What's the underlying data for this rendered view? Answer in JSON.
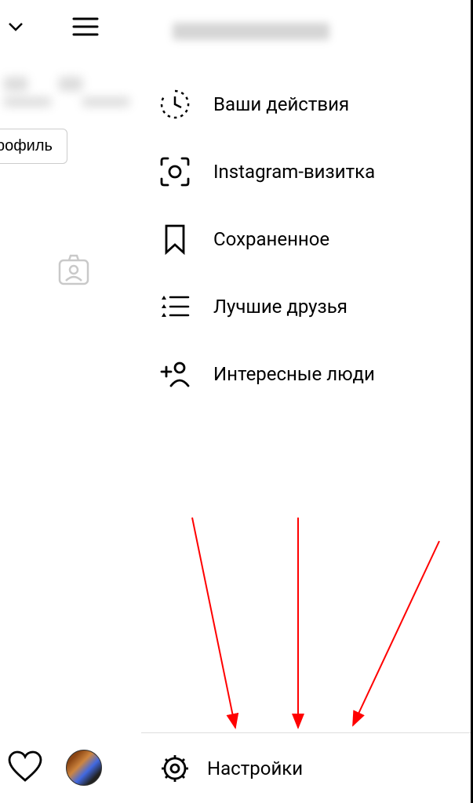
{
  "header": {
    "username_blurred": true
  },
  "profile": {
    "edit_profile_label": "ть профиль"
  },
  "menu": {
    "items": [
      {
        "icon": "activity-icon",
        "label": "Ваши действия"
      },
      {
        "icon": "qr-icon",
        "label": "Instagram-визитка"
      },
      {
        "icon": "bookmark-icon",
        "label": "Сохраненное"
      },
      {
        "icon": "close-friends-icon",
        "label": "Лучшие друзья"
      },
      {
        "icon": "discover-people-icon",
        "label": "Интересные люди"
      }
    ]
  },
  "settings": {
    "label": "Настройки"
  }
}
